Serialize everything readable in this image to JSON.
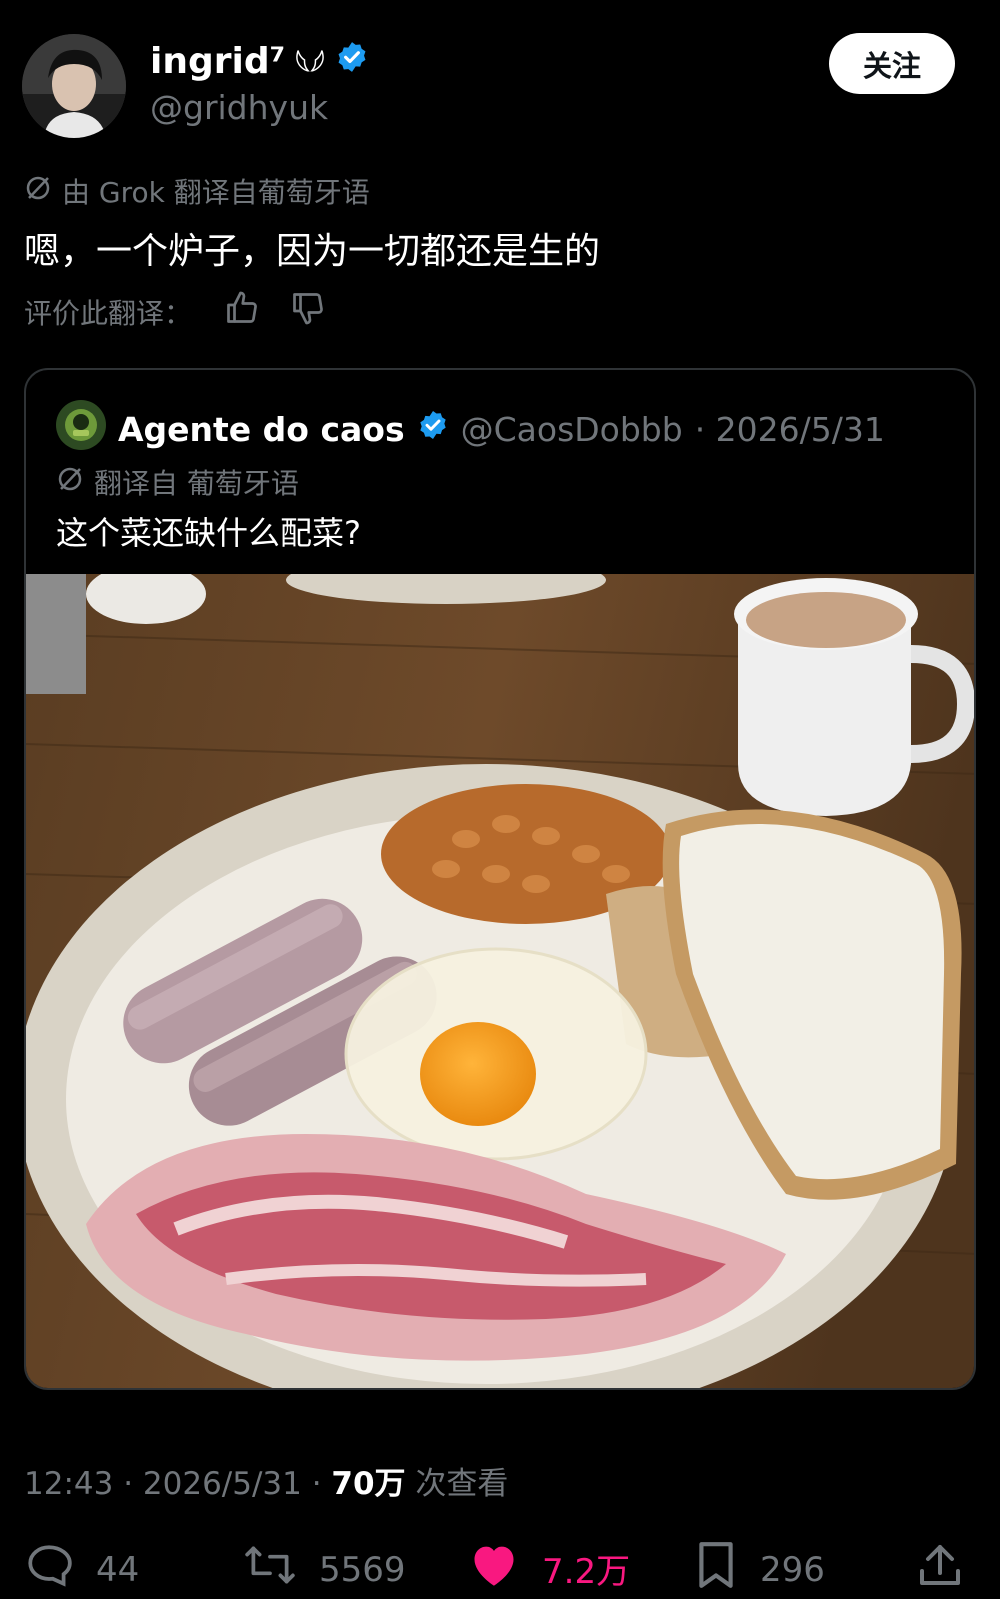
{
  "author": {
    "name": "ingrid⁷",
    "handle": "@gridhyuk",
    "badge_glyph": "𓆩𓆪",
    "follow_label": "关注"
  },
  "translation_note": "由 Grok 翻译自葡萄牙语",
  "tweet_text": "嗯，一个炉子，因为一切都还是生的",
  "rate_translation_label": "评价此翻译：",
  "quoted": {
    "name": "Agente do caos",
    "handle": "@CaosDobbb",
    "date": "· 2026/5/31",
    "translation_note": "翻译自 葡萄牙语",
    "text": "这个菜还缺什么配菜?"
  },
  "meta": {
    "time": "12:43 · 2026/5/31 · ",
    "views": "70万",
    "views_label": " 次查看"
  },
  "actions": {
    "replies": "44",
    "retweets": "5569",
    "likes": "7.2万",
    "bookmarks": "296"
  },
  "colors": {
    "verified": "#1d9bf0",
    "like": "#f91880",
    "muted": "#71767b"
  }
}
